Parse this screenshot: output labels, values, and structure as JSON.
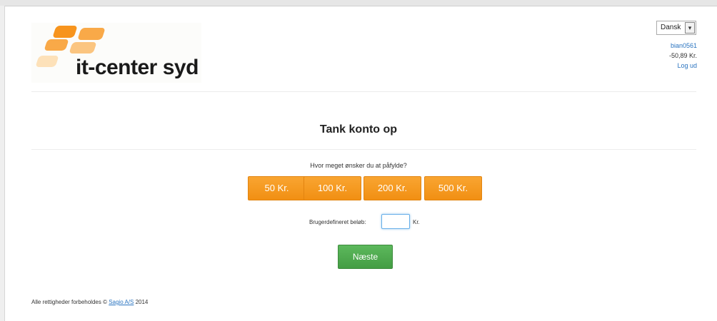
{
  "header": {
    "logo_text": "it-center syd",
    "brand_colors": [
      "#f7941d",
      "#f9a948",
      "#fbc580",
      "#fde1b9"
    ],
    "language": {
      "selected": "Dansk"
    },
    "account": {
      "username": "bian0561",
      "balance": "-50,89 Kr.",
      "logout": "Log ud"
    }
  },
  "main": {
    "title": "Tank konto op",
    "question": "Hvor meget ønsker du at påfylde?",
    "amount_buttons": [
      "50 Kr.",
      "100 Kr.",
      "200 Kr.",
      "500 Kr."
    ],
    "custom_amount": {
      "label": "Brugerdefineret beløb:",
      "value": "",
      "unit": "Kr."
    },
    "next_button": "Næste"
  },
  "footer": {
    "text": "Alle rettigheder forbeholdes ©",
    "link": "Sagio A/S",
    "year": "2014"
  },
  "colors": {
    "accent_orange": "#f7941d",
    "next_green": "#5cb85c",
    "link_blue": "#2a74c0"
  }
}
